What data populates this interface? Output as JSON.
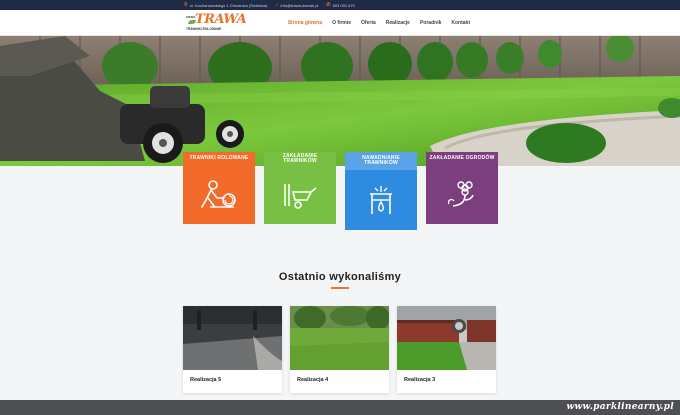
{
  "topbar": {
    "address": "ul. Kochanowskiego 1 Chrośnica (Świdnica)",
    "email": "info@trawa-darzak.pl",
    "phone": "603 091 670"
  },
  "logo": {
    "mark": "SIEMA",
    "word": "TRAWA",
    "sub": "TRAWNIKI ROLOWANE"
  },
  "nav": {
    "items": [
      "Strona główna",
      "O firmie",
      "Oferta",
      "Realizacje",
      "Poradnik",
      "Kontakt"
    ]
  },
  "services": [
    {
      "label": "TRAWNIKI ROLOWANE",
      "color": "#f26b2a",
      "icon": "sod-roll-icon"
    },
    {
      "label": "ZAKŁADANIE TRAWNIKÓW",
      "color": "#78c043",
      "icon": "wheelbarrow-icon"
    },
    {
      "label": "NAWADNIANIE TRAWNIKÓW",
      "color": "#2f8be0",
      "icon": "sprinkler-icon"
    },
    {
      "label": "ZAKŁADANIE OGRODÓW",
      "color": "#7b3f7e",
      "icon": "flower-icon"
    }
  ],
  "projects": {
    "title": "Ostatnio wykonaliśmy",
    "items": [
      {
        "caption": "Realizacja 5"
      },
      {
        "caption": "Realizacja 4"
      },
      {
        "caption": "Realizacja 3"
      }
    ]
  },
  "watermark": "www.parklinearny.pl",
  "colors": {
    "accent": "#e8732a",
    "topbar": "#1f2a44"
  }
}
